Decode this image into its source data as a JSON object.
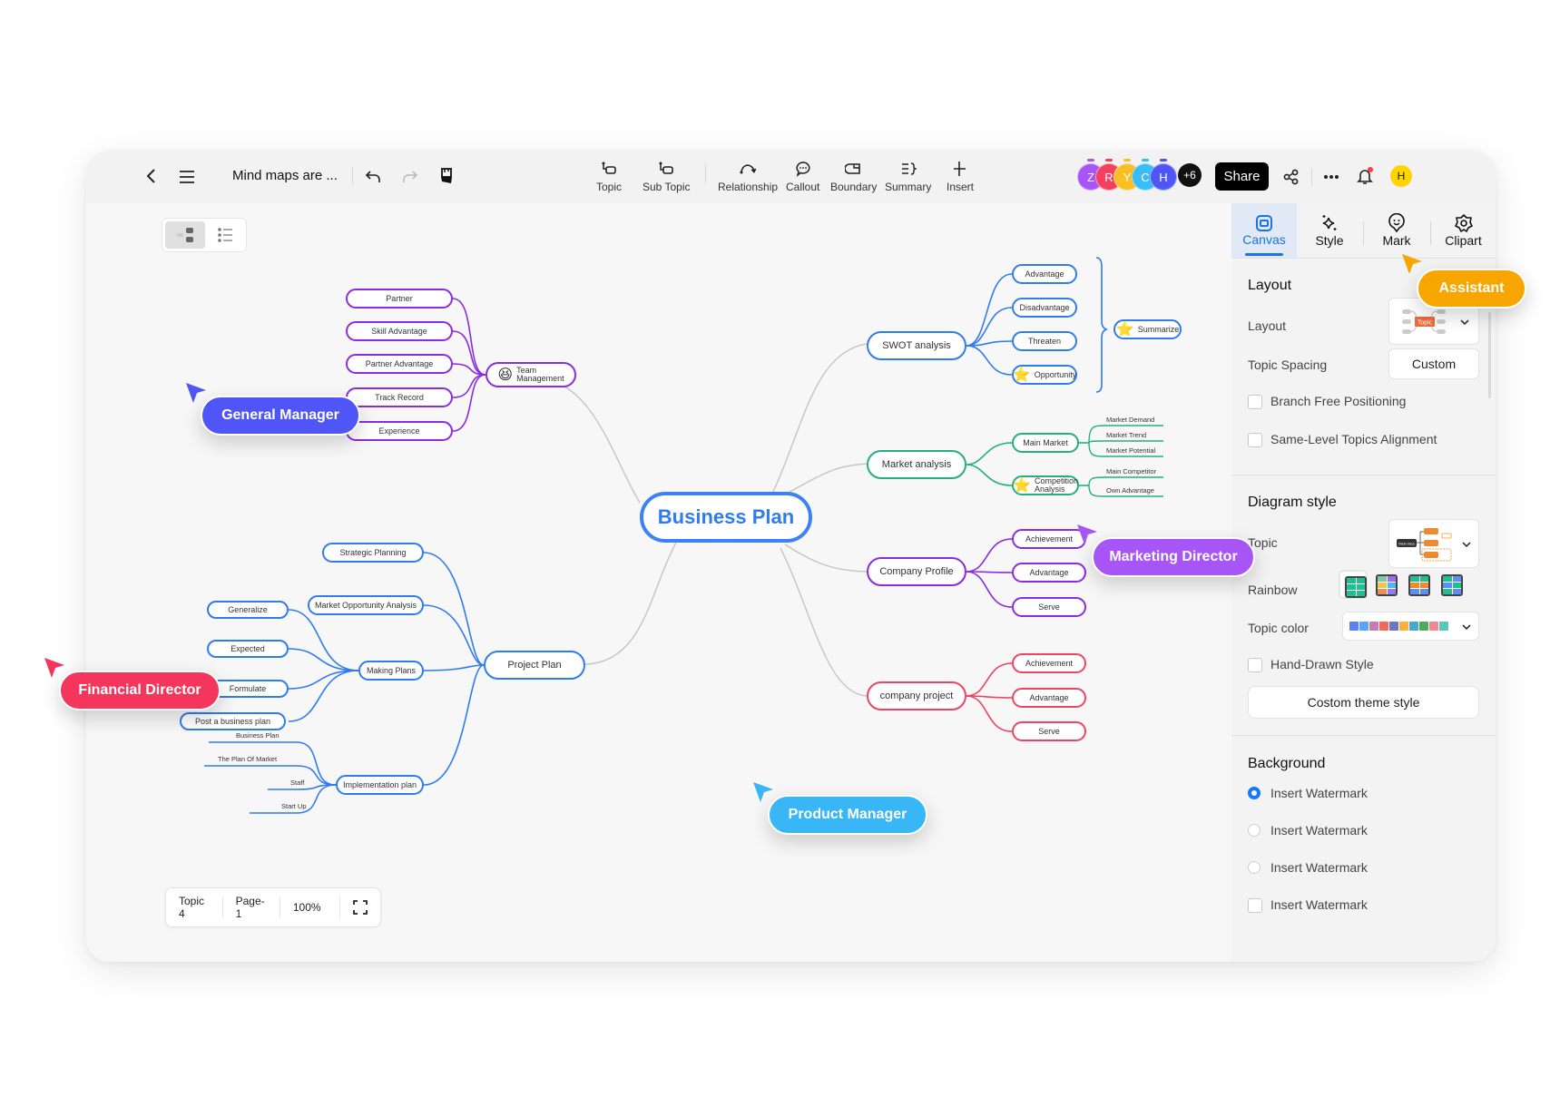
{
  "app": {
    "document_title": "Mind maps are ...",
    "nav": {
      "back_icon": "chevron-left-icon",
      "menu_icon": "hamburger-menu-icon",
      "undo_icon": "undo-icon",
      "redo_icon": "redo-icon",
      "format_painter_icon": "format-painter-icon"
    }
  },
  "toolbar": {
    "tools": [
      {
        "label": "Topic",
        "icon": "topic-icon"
      },
      {
        "label": "Sub Topic",
        "icon": "subtopic-icon"
      },
      {
        "label": "Relationship",
        "icon": "relationship-icon"
      },
      {
        "label": "Callout",
        "icon": "callout-icon"
      },
      {
        "label": "Boundary",
        "icon": "boundary-icon"
      },
      {
        "label": "Summary",
        "icon": "summary-icon"
      },
      {
        "label": "Insert",
        "icon": "insert-icon"
      }
    ],
    "collaborators": [
      {
        "initial": "Z",
        "color": "#a855f7"
      },
      {
        "initial": "R",
        "color": "#f43f5e"
      },
      {
        "initial": "Y",
        "color": "#fbbf24"
      },
      {
        "initial": "C",
        "color": "#38bdf8"
      },
      {
        "initial": "H",
        "color": "#4f56f5"
      }
    ],
    "more_collaborators": "+6",
    "share_label": "Share",
    "user_initial": "H"
  },
  "canvas": {
    "view_modes": [
      "mind-map-view",
      "outline-view"
    ],
    "root": "Business Plan",
    "branches": {
      "team_management": {
        "label_line1": "Team",
        "label_line2": "Management",
        "emoji": "😆",
        "color": "#8b2be2",
        "children": [
          "Partner",
          "Skill Advantage",
          "Partner Advantage",
          "Track Record",
          "Experience"
        ]
      },
      "swot": {
        "label": "SWOT analysis",
        "color": "#2f7bf0",
        "children": [
          "Advantage",
          "Disadvantage",
          "Threaten",
          "Opportunity"
        ],
        "summary": "Summarize"
      },
      "market": {
        "label": "Market analysis",
        "color": "#22b07d",
        "children": [
          {
            "label": "Main Market",
            "leaves": [
              "Market Demand",
              "Market Trend",
              "Market Potential"
            ]
          },
          {
            "label_line1": "Competition",
            "label_line2": "Analysis",
            "leaves": [
              "Main Competitor",
              "Own Advantage"
            ]
          }
        ]
      },
      "company_profile": {
        "label": "Company Profile",
        "color": "#8b2be2",
        "children": [
          "Achievement",
          "Advantage",
          "Serve"
        ]
      },
      "company_project": {
        "label": "company project",
        "color": "#ef4461",
        "children": [
          "Achievement",
          "Advantage",
          "Serve"
        ]
      },
      "project_plan": {
        "label": "Project Plan",
        "color": "#2f7bf0",
        "children": [
          {
            "label": "Strategic Planning"
          },
          {
            "label": "Market Opportunity Analysis"
          },
          {
            "label": "Making Plans",
            "children": [
              "Generalize",
              "Expected",
              "Formulate",
              "Post a business plan"
            ]
          },
          {
            "label": "Implementation plan",
            "leaves": [
              "Business Plan",
              "The Plan Of Market",
              "Staff",
              "Start Up"
            ]
          }
        ]
      }
    },
    "status": {
      "topic": "Topic 4",
      "page": "Page-1",
      "zoom": "100%"
    },
    "cursors": [
      {
        "name": "General Manager",
        "color": "#4f56f5"
      },
      {
        "name": "Financial Director",
        "color": "#f5365c"
      },
      {
        "name": "Marketing Director",
        "color": "#a855f7"
      },
      {
        "name": "Product Manager",
        "color": "#38b6f5"
      },
      {
        "name": "Assistant",
        "color": "#f7a600"
      }
    ]
  },
  "panel": {
    "tabs": [
      {
        "label": "Canvas",
        "icon": "canvas-icon",
        "active": true
      },
      {
        "label": "Style",
        "icon": "sparkle-icon"
      },
      {
        "label": "Mark",
        "icon": "mark-icon"
      },
      {
        "label": "Clipart",
        "icon": "clipart-icon"
      }
    ],
    "layout": {
      "title": "Layout",
      "layout_label": "Layout",
      "layout_preview_text": "Topic",
      "spacing_label": "Topic Spacing",
      "spacing_value": "Custom",
      "branch_free": "Branch Free Positioning",
      "same_level": "Same-Level Topics Alignment"
    },
    "diagram_style": {
      "title": "Diagram style",
      "topic_label": "Topic",
      "topic_preview_text": "Main Idea",
      "rainbow_label": "Rainbow",
      "topic_color_label": "Topic color",
      "topic_colors": [
        "#5b7ff5",
        "#5aa6f5",
        "#c77bb3",
        "#ef6a5a",
        "#6c77c0",
        "#f6b23c",
        "#4aa8cc",
        "#4dab5b",
        "#ef8895",
        "#58c7b7"
      ],
      "hand_drawn": "Hand-Drawn Style",
      "custom_theme": "Costom theme style"
    },
    "background": {
      "title": "Background",
      "options": [
        {
          "label": "Insert Watermark",
          "type": "radio",
          "checked": true
        },
        {
          "label": "Insert Watermark",
          "type": "radio",
          "checked": false
        },
        {
          "label": "Insert Watermark",
          "type": "radio",
          "checked": false
        },
        {
          "label": "Insert Watermark",
          "type": "checkbox",
          "checked": false
        }
      ]
    }
  }
}
